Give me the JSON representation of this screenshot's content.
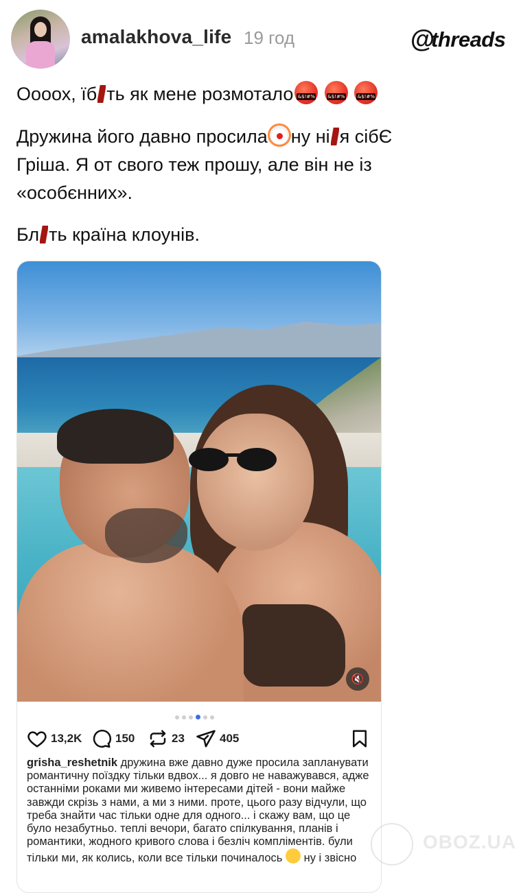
{
  "header": {
    "username": "amalakhova_life",
    "time": "19 год",
    "brand": "threads",
    "brand_symbol": "@"
  },
  "post": {
    "line1": "Оооох, їб",
    "line1_b": "ть як мене розмотало",
    "para2_a": "Дружина його давно просила",
    "para2_b": "ну ні",
    "para2_c": "я сібЄ",
    "para2_line2": "Гріша. Я от свого теж прошу, але він не із",
    "para2_line3": "«особєнних».",
    "para3_a": "Бл",
    "para3_b": "ть країна клоунів."
  },
  "embed": {
    "mute_icon": "🔇",
    "carousel_dots": 6,
    "active_dot": 3,
    "stats": {
      "likes": "13,2K",
      "comments": "150",
      "reposts": "23",
      "shares": "405"
    },
    "caption_user": "grisha_reshetnik",
    "caption_text": "дружина вже давно дуже просила запланувати романтичну поїздку тільки вдвох... я довго не наважувався, адже останніми роками ми живемо інтересами дітей - вони майже завжди скрізь з нами, а ми з ними. проте, цього разу відчули, що треба знайти час тільки одне для одного... і скажу вам, що це було незабутньо. теплі вечори, багато спілкування, планів і романтики, жодного кривого слова і безліч компліментів. були тільки ми, як колись, коли все тільки починалось",
    "caption_tail": "ну і звісно"
  },
  "watermark": {
    "text": "OBOZ.UA"
  },
  "colors": {
    "accent_dot": "#3a6ee8",
    "censor": "#a31612",
    "time": "#9a9a9a"
  }
}
